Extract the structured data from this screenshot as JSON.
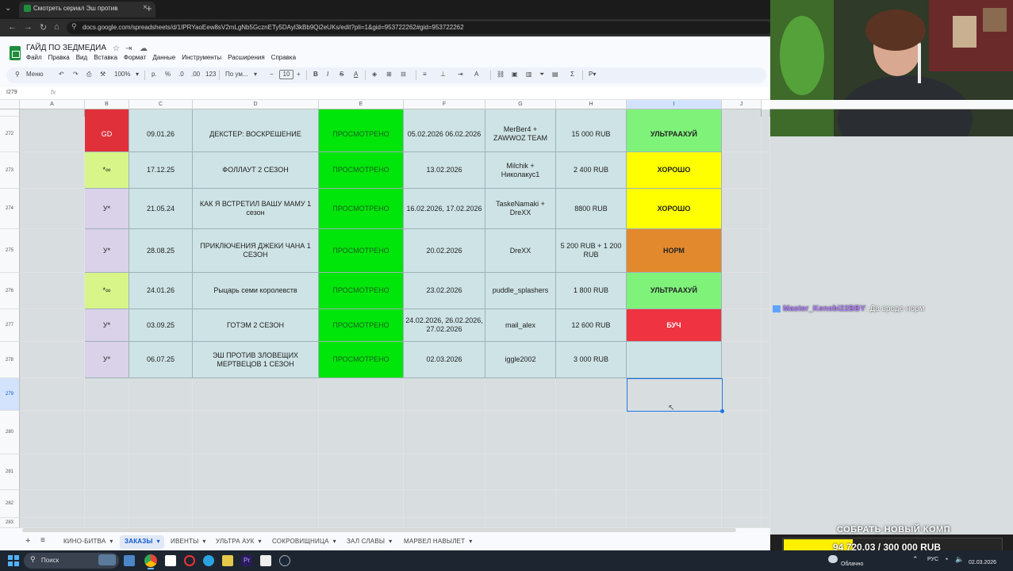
{
  "browser": {
    "tab_title": "Смотреть сериал Эш против",
    "url": "docs.google.com/spreadsheets/d/1IPRYaoEew8sV2mLgNb5GcznETy5DAyl3kBb9Qi2eUKs/edit?pli=1&gid=953722262#gid=953722262"
  },
  "doc": {
    "title": "ГАЙД ПО ЗЕДМЕДИА",
    "menus": [
      "Файл",
      "Правка",
      "Вид",
      "Вставка",
      "Формат",
      "Данные",
      "Инструменты",
      "Расширения",
      "Справка"
    ],
    "toolbar": {
      "search": "Меню",
      "zoom": "100%",
      "currency": "р.",
      "percent": "%",
      "dec_down": ".0",
      "dec_up": ".00",
      "number_fmt": "123",
      "font": "По ум...",
      "font_size": "10"
    },
    "name_box": "I279",
    "fx": "fx"
  },
  "columns": [
    "A",
    "B",
    "C",
    "D",
    "E",
    "F",
    "G",
    "H",
    "I",
    "J"
  ],
  "rows": [
    {
      "num": "272",
      "b": "GD",
      "c": "09.01.26",
      "d": "ДЕКСТЕР: ВОСКРЕШЕНИЕ",
      "e": "ПРОСМОТРЕНО",
      "f": "05.02.2026 06.02.2026",
      "g": "MerBer4 + ZAWWOZ TEAM",
      "h": "15 000 RUB",
      "i": "УЛЬТРААХУЙ"
    },
    {
      "num": "273",
      "b": "*∞",
      "c": "17.12.25",
      "d": "ФОЛЛАУТ 2 СЕЗОН",
      "e": "ПРОСМОТРЕНО",
      "f": "13.02.2026",
      "g": "Milchik + Николакус1",
      "h": "2 400 RUB",
      "i": "ХОРОШО"
    },
    {
      "num": "274",
      "b": "У*",
      "c": "21.05.24",
      "d": "КАК Я ВСТРЕТИЛ ВАШУ МАМУ 1 сезон",
      "e": "ПРОСМОТРЕНО",
      "f": "16.02.2026, 17.02.2026",
      "g": "TaskeNamaki + DreXX",
      "h": "8800 RUB",
      "i": "ХОРОШО"
    },
    {
      "num": "275",
      "b": "У*",
      "c": "28.08.25",
      "d": "ПРИКЛЮЧЕНИЯ ДЖЕКИ ЧАНА 1 СЕЗОН",
      "e": "ПРОСМОТРЕНО",
      "f": "20.02.2026",
      "g": "DreXX",
      "h": "5 200 RUB + 1 200 RUB",
      "i": "НОРМ"
    },
    {
      "num": "276",
      "b": "*∞",
      "c": "24.01.26",
      "d": "Рыцарь семи королевств",
      "e": "ПРОСМОТРЕНО",
      "f": "23.02.2026",
      "g": "puddle_splashers",
      "h": "1 800 RUB",
      "i": "УЛЬТРААХУЙ"
    },
    {
      "num": "277",
      "b": "У*",
      "c": "03.09.25",
      "d": "ГОТЭМ 2 СЕЗОН",
      "e": "ПРОСМОТРЕНО",
      "f": "24.02.2026, 26.02.2026, 27.02.2026",
      "g": "mail_alex",
      "h": "12 600 RUB",
      "i": "БУЧ"
    },
    {
      "num": "278",
      "b": "У*",
      "c": "06.07.25",
      "d": "ЭШ ПРОТИВ ЗЛОВЕЩИХ МЕРТВЕЦОВ 1 СЕЗОН",
      "e": "ПРОСМОТРЕНО",
      "f": "02.03.2026",
      "g": "iggle2002",
      "h": "3 000 RUB",
      "i": ""
    }
  ],
  "empty_rows": [
    "279",
    "280",
    "281",
    "282",
    "283"
  ],
  "colors": {
    "b_gd": "#e0303a",
    "b_inf": "#d7f589",
    "b_u": "#d9d2e9",
    "e": "#00e50a",
    "ultra": "#7ff27a",
    "good": "#ffff00",
    "norm": "#e2892e",
    "buch": "#ef3340",
    "cell": "#cee3e5"
  },
  "sheet_tabs": [
    "КИНО-БИТВА",
    "ЗАКАЗЫ",
    "ИВЕНТЫ",
    "УЛЬТРА АУК",
    "СОКРОВИЩНИЦА",
    "ЗАЛ СЛАВЫ",
    "МАРВЕЛ НАВЫЛЕТ"
  ],
  "active_sheet": "ЗАКАЗЫ",
  "chat": {
    "nick": "Master_Kenobi22BBY",
    "message": ": Да вроде норм"
  },
  "goal": {
    "title": "СОБРАТЬ НОВЫЙ КОМП",
    "text": "94 720.03 / 300 000 RUB",
    "progress": 0.3157
  },
  "taskbar": {
    "search": "Поиск",
    "weather": "Облачно",
    "lang": "РУС",
    "date": "02.03.2026"
  }
}
